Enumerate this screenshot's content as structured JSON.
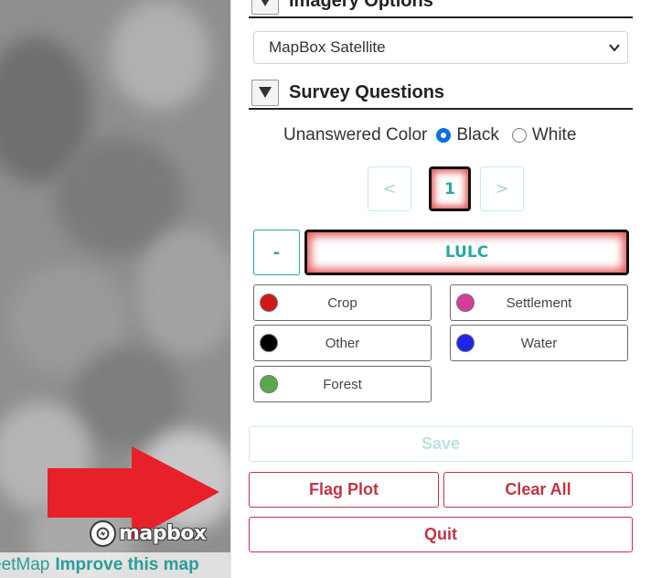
{
  "map": {
    "logo_text": "mapbox",
    "attribution": {
      "osm_text": "eetMap",
      "improve_text": "Improve this map"
    },
    "annotation_arrow_color": "#e8202a"
  },
  "sidebar": {
    "imagery_section": {
      "title": "Imagery Options",
      "selected_imagery": "MapBox Satellite"
    },
    "survey_section": {
      "title": "Survey Questions"
    },
    "unanswered_color": {
      "label": "Unanswered Color",
      "options": [
        {
          "label": "Black",
          "checked": true
        },
        {
          "label": "White",
          "checked": false
        }
      ]
    },
    "pager": {
      "prev": "<",
      "current": "1",
      "next": ">"
    },
    "question": {
      "collapse_label": "-",
      "title": "LULC"
    },
    "answers": [
      {
        "label": "Crop",
        "color": "#d11919"
      },
      {
        "label": "Settlement",
        "color": "#d63c9b"
      },
      {
        "label": "Other",
        "color": "#000000"
      },
      {
        "label": "Water",
        "color": "#1f24e6"
      },
      {
        "label": "Forest",
        "color": "#5aa84f"
      }
    ],
    "actions": {
      "save": "Save",
      "flag": "Flag Plot",
      "clear": "Clear All",
      "quit": "Quit"
    }
  },
  "theme": {
    "accent_teal": "#2aa7a1",
    "danger_red": "#c03545",
    "radio_blue": "#0b6fe0"
  }
}
